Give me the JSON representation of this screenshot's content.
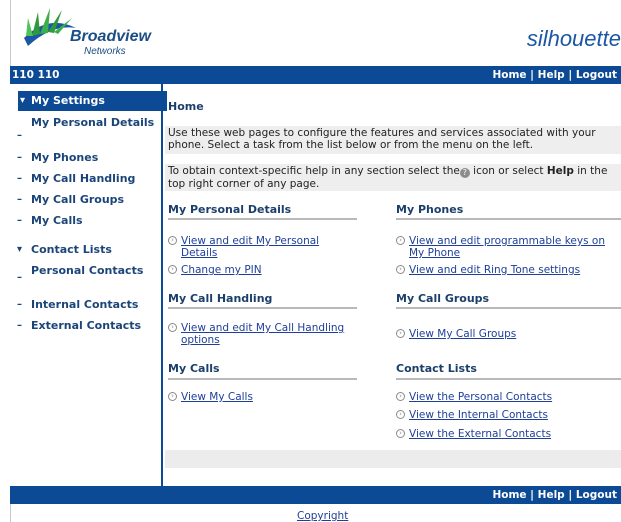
{
  "header": {
    "logo_name": "Broadview",
    "logo_sub": "Networks",
    "brand": "silhouette",
    "user_id": "110 110",
    "top_links": [
      "Home",
      "Help",
      "Logout"
    ],
    "separator": "|"
  },
  "sidebar": {
    "items": [
      {
        "label": "My Settings",
        "marker": "▾",
        "active": true
      },
      {
        "label": "My Personal Details",
        "marker": "–"
      },
      {
        "label": "My Phones",
        "marker": "–"
      },
      {
        "label": "My Call Handling",
        "marker": "–"
      },
      {
        "label": "My Call Groups",
        "marker": "–"
      },
      {
        "label": "My Calls",
        "marker": "–"
      },
      {
        "label": "Contact Lists",
        "marker": "▾"
      },
      {
        "label": "Personal Contacts",
        "marker": "–"
      },
      {
        "label": "Internal Contacts",
        "marker": "–"
      },
      {
        "label": "External Contacts",
        "marker": "–"
      }
    ]
  },
  "main": {
    "breadcrumb": "Home",
    "intro": "Use these web pages to configure the features and services associated with your phone. Select a task from the list below or from the menu on the left.",
    "help_pre": "To obtain context-specific help in any section select the",
    "help_mid": " icon or select ",
    "help_bold": "Help",
    "help_post": " in the top right corner of any page.",
    "sections": [
      {
        "title": "My Personal Details",
        "links": [
          "View and edit My Personal Details",
          "Change my PIN"
        ]
      },
      {
        "title": "My Phones",
        "links": [
          "View and edit programmable keys on My Phone",
          "View and edit Ring Tone settings"
        ]
      },
      {
        "title": "My Call Handling",
        "links": [
          "View and edit My Call Handling options"
        ]
      },
      {
        "title": "My Call Groups",
        "links": [
          "View My Call Groups"
        ]
      },
      {
        "title": "My Calls",
        "links": [
          "View My Calls"
        ]
      },
      {
        "title": "Contact Lists",
        "links": [
          "View the Personal Contacts",
          "View the Internal Contacts",
          "View the External Contacts"
        ]
      }
    ]
  },
  "footer": {
    "links": [
      "Home",
      "Help",
      "Logout"
    ],
    "copyright": "Copyright"
  },
  "colors": {
    "nav_blue": "#0d4a95",
    "link_blue": "#1e3f9a",
    "panel_grey": "#eeeeee"
  }
}
